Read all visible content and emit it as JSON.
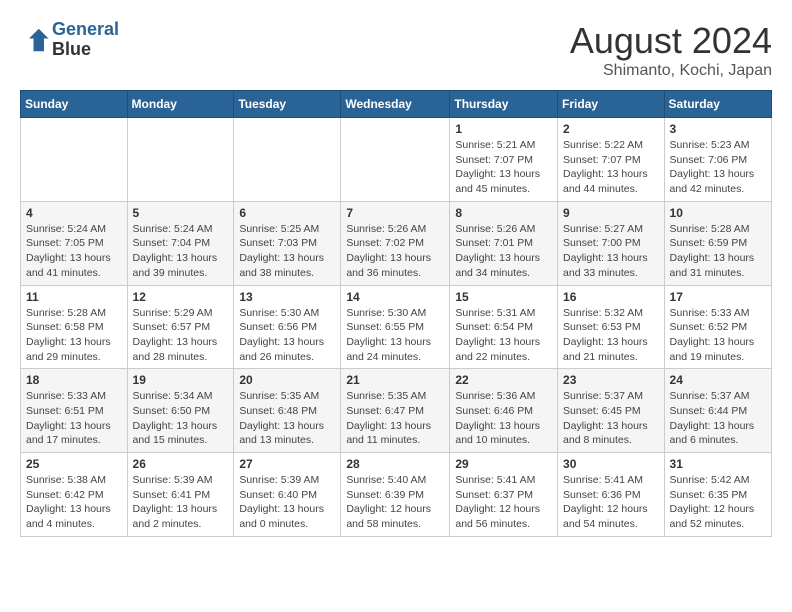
{
  "header": {
    "logo_line1": "General",
    "logo_line2": "Blue",
    "month_year": "August 2024",
    "location": "Shimanto, Kochi, Japan"
  },
  "weekdays": [
    "Sunday",
    "Monday",
    "Tuesday",
    "Wednesday",
    "Thursday",
    "Friday",
    "Saturday"
  ],
  "weeks": [
    [
      {
        "day": "",
        "info": ""
      },
      {
        "day": "",
        "info": ""
      },
      {
        "day": "",
        "info": ""
      },
      {
        "day": "",
        "info": ""
      },
      {
        "day": "1",
        "info": "Sunrise: 5:21 AM\nSunset: 7:07 PM\nDaylight: 13 hours\nand 45 minutes."
      },
      {
        "day": "2",
        "info": "Sunrise: 5:22 AM\nSunset: 7:07 PM\nDaylight: 13 hours\nand 44 minutes."
      },
      {
        "day": "3",
        "info": "Sunrise: 5:23 AM\nSunset: 7:06 PM\nDaylight: 13 hours\nand 42 minutes."
      }
    ],
    [
      {
        "day": "4",
        "info": "Sunrise: 5:24 AM\nSunset: 7:05 PM\nDaylight: 13 hours\nand 41 minutes."
      },
      {
        "day": "5",
        "info": "Sunrise: 5:24 AM\nSunset: 7:04 PM\nDaylight: 13 hours\nand 39 minutes."
      },
      {
        "day": "6",
        "info": "Sunrise: 5:25 AM\nSunset: 7:03 PM\nDaylight: 13 hours\nand 38 minutes."
      },
      {
        "day": "7",
        "info": "Sunrise: 5:26 AM\nSunset: 7:02 PM\nDaylight: 13 hours\nand 36 minutes."
      },
      {
        "day": "8",
        "info": "Sunrise: 5:26 AM\nSunset: 7:01 PM\nDaylight: 13 hours\nand 34 minutes."
      },
      {
        "day": "9",
        "info": "Sunrise: 5:27 AM\nSunset: 7:00 PM\nDaylight: 13 hours\nand 33 minutes."
      },
      {
        "day": "10",
        "info": "Sunrise: 5:28 AM\nSunset: 6:59 PM\nDaylight: 13 hours\nand 31 minutes."
      }
    ],
    [
      {
        "day": "11",
        "info": "Sunrise: 5:28 AM\nSunset: 6:58 PM\nDaylight: 13 hours\nand 29 minutes."
      },
      {
        "day": "12",
        "info": "Sunrise: 5:29 AM\nSunset: 6:57 PM\nDaylight: 13 hours\nand 28 minutes."
      },
      {
        "day": "13",
        "info": "Sunrise: 5:30 AM\nSunset: 6:56 PM\nDaylight: 13 hours\nand 26 minutes."
      },
      {
        "day": "14",
        "info": "Sunrise: 5:30 AM\nSunset: 6:55 PM\nDaylight: 13 hours\nand 24 minutes."
      },
      {
        "day": "15",
        "info": "Sunrise: 5:31 AM\nSunset: 6:54 PM\nDaylight: 13 hours\nand 22 minutes."
      },
      {
        "day": "16",
        "info": "Sunrise: 5:32 AM\nSunset: 6:53 PM\nDaylight: 13 hours\nand 21 minutes."
      },
      {
        "day": "17",
        "info": "Sunrise: 5:33 AM\nSunset: 6:52 PM\nDaylight: 13 hours\nand 19 minutes."
      }
    ],
    [
      {
        "day": "18",
        "info": "Sunrise: 5:33 AM\nSunset: 6:51 PM\nDaylight: 13 hours\nand 17 minutes."
      },
      {
        "day": "19",
        "info": "Sunrise: 5:34 AM\nSunset: 6:50 PM\nDaylight: 13 hours\nand 15 minutes."
      },
      {
        "day": "20",
        "info": "Sunrise: 5:35 AM\nSunset: 6:48 PM\nDaylight: 13 hours\nand 13 minutes."
      },
      {
        "day": "21",
        "info": "Sunrise: 5:35 AM\nSunset: 6:47 PM\nDaylight: 13 hours\nand 11 minutes."
      },
      {
        "day": "22",
        "info": "Sunrise: 5:36 AM\nSunset: 6:46 PM\nDaylight: 13 hours\nand 10 minutes."
      },
      {
        "day": "23",
        "info": "Sunrise: 5:37 AM\nSunset: 6:45 PM\nDaylight: 13 hours\nand 8 minutes."
      },
      {
        "day": "24",
        "info": "Sunrise: 5:37 AM\nSunset: 6:44 PM\nDaylight: 13 hours\nand 6 minutes."
      }
    ],
    [
      {
        "day": "25",
        "info": "Sunrise: 5:38 AM\nSunset: 6:42 PM\nDaylight: 13 hours\nand 4 minutes."
      },
      {
        "day": "26",
        "info": "Sunrise: 5:39 AM\nSunset: 6:41 PM\nDaylight: 13 hours\nand 2 minutes."
      },
      {
        "day": "27",
        "info": "Sunrise: 5:39 AM\nSunset: 6:40 PM\nDaylight: 13 hours\nand 0 minutes."
      },
      {
        "day": "28",
        "info": "Sunrise: 5:40 AM\nSunset: 6:39 PM\nDaylight: 12 hours\nand 58 minutes."
      },
      {
        "day": "29",
        "info": "Sunrise: 5:41 AM\nSunset: 6:37 PM\nDaylight: 12 hours\nand 56 minutes."
      },
      {
        "day": "30",
        "info": "Sunrise: 5:41 AM\nSunset: 6:36 PM\nDaylight: 12 hours\nand 54 minutes."
      },
      {
        "day": "31",
        "info": "Sunrise: 5:42 AM\nSunset: 6:35 PM\nDaylight: 12 hours\nand 52 minutes."
      }
    ]
  ]
}
